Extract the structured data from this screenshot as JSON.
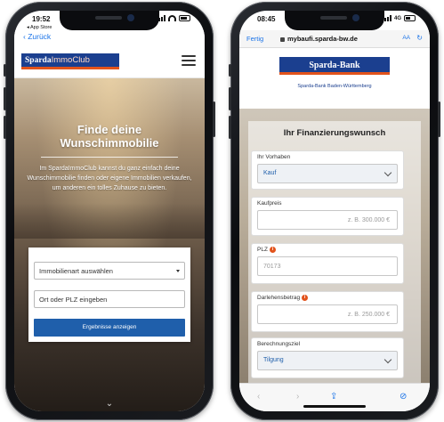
{
  "left_phone": {
    "status": {
      "time": "19:52",
      "back_app": "◂ App Store"
    },
    "back_link": "Zurück",
    "logo": {
      "part1": "Sparda",
      "part2": "ImmoClub"
    },
    "hero": {
      "title_line1": "Finde deine",
      "title_line2": "Wunschimmobilie",
      "text": "Im SpardaImmoClub kannst du ganz einfach deine Wunschimmobilie finden oder eigene Immobilien verkaufen, um anderen ein tolles Zuhause zu bieten."
    },
    "search": {
      "property_type_placeholder": "Immobilienart auswählen",
      "location_placeholder": "Ort oder PLZ eingeben",
      "submit_label": "Ergebnisse anzeigen"
    },
    "scroll_hint": "⌄"
  },
  "right_phone": {
    "status": {
      "time": "08:45",
      "network": "4G"
    },
    "browser": {
      "done_label": "Fertig",
      "url": "mybaufi.sparda-bw.de",
      "text_size": "AA",
      "reload": "↻"
    },
    "bank": {
      "logo": "Sparda-Bank",
      "subtitle": "Sparda-Bank Baden-Württemberg"
    },
    "form": {
      "title": "Ihr Finanzierungswunsch",
      "fields": [
        {
          "label": "Ihr Vorhaben",
          "value": "Kauf",
          "kind": "select"
        },
        {
          "label": "Kaufpreis",
          "placeholder": "z. B. 300.000 €",
          "kind": "input"
        },
        {
          "label": "PLZ",
          "placeholder": "70173",
          "kind": "input",
          "info": true
        },
        {
          "label": "Darlehensbetrag",
          "placeholder": "z. B. 250.000 €",
          "kind": "input",
          "info": true
        },
        {
          "label": "Berechnungsziel",
          "value": "Tilgung",
          "kind": "select"
        }
      ],
      "info_glyph": "i"
    },
    "toolbar": {
      "back": "‹",
      "forward": "›",
      "share": "⇪",
      "safari": "⊘"
    }
  }
}
